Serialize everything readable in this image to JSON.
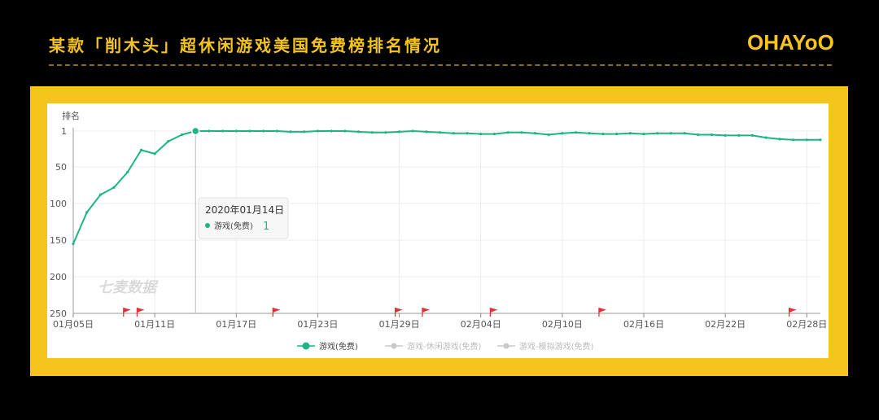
{
  "header": {
    "title": "某款「削木头」超休闲游戏美国免费榜排名情况",
    "logo": "OHAYoO"
  },
  "colors": {
    "accent": "#F6C51B",
    "series_main": "#1DB584",
    "series_inactive": "#C8C8C8",
    "flag": "#E8303A"
  },
  "chart_data": {
    "type": "line",
    "ylabel": "排名",
    "y_reversed": true,
    "ylim": [
      1,
      250
    ],
    "yticks": [
      1,
      50,
      100,
      150,
      200,
      250
    ],
    "x_tick_labels": [
      "01月05日",
      "01月11日",
      "01月17日",
      "01月23日",
      "01月29日",
      "02月04日",
      "02月10日",
      "02月16日",
      "02月22日",
      "02月28日"
    ],
    "grid": true,
    "watermark": "七麦数据",
    "legend_position": "bottom-center",
    "legend": [
      {
        "name": "游戏(免费)",
        "active": true
      },
      {
        "name": "游戏-休闲游戏(免费)",
        "active": false
      },
      {
        "name": "游戏-模拟游戏(免费)",
        "active": false
      }
    ],
    "series": [
      {
        "name": "游戏(免费)",
        "values": [
          155,
          112,
          88,
          78,
          57,
          27,
          32,
          15,
          6,
          1,
          1,
          1,
          1,
          1,
          1,
          1,
          2,
          2,
          1,
          1,
          1,
          2,
          3,
          3,
          2,
          1,
          2,
          3,
          4,
          4,
          5,
          5,
          3,
          3,
          4,
          6,
          4,
          3,
          4,
          5,
          5,
          4,
          5,
          4,
          4,
          4,
          6,
          6,
          7,
          7,
          7,
          10,
          12,
          13,
          13,
          13
        ]
      }
    ],
    "tooltip": {
      "date": "2020年01月14日",
      "series": "游戏(免费)",
      "value": "1"
    },
    "flags_count": 8
  }
}
